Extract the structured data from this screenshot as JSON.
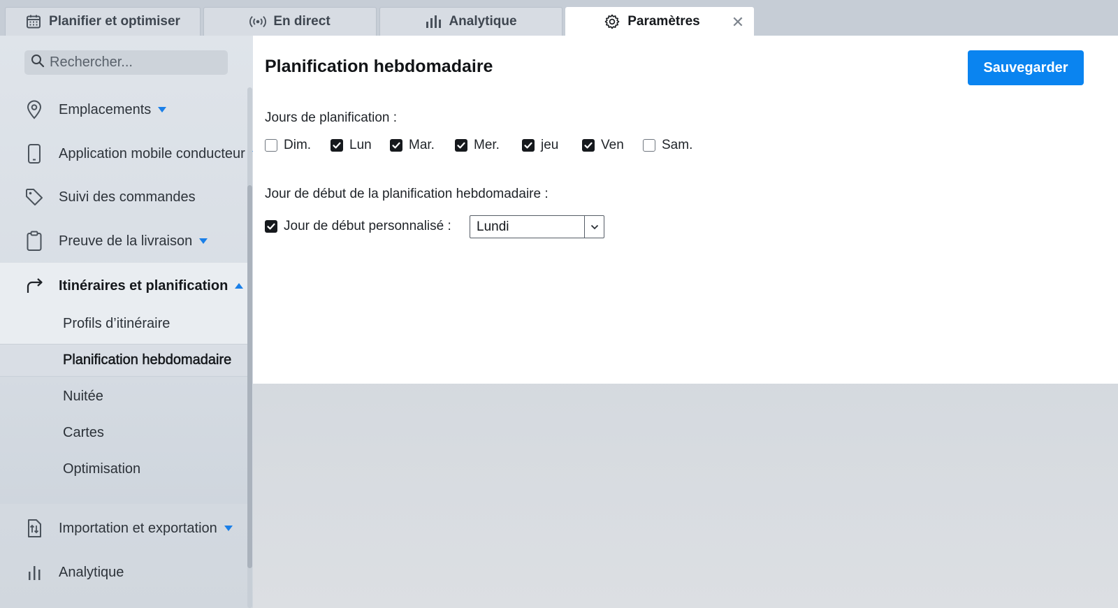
{
  "tabs": [
    {
      "label": "Planifier et optimiser",
      "icon": "calendar-icon"
    },
    {
      "label": "En direct",
      "icon": "broadcast-icon"
    },
    {
      "label": "Analytique",
      "icon": "bar-chart-icon"
    },
    {
      "label": "Paramètres",
      "icon": "gear-icon",
      "active": true
    }
  ],
  "tab_close_glyph": "✕",
  "sidebar": {
    "search_placeholder": "Rechercher...",
    "items": [
      {
        "label": "Emplacements",
        "icon": "map-pin-icon",
        "expandable": true
      },
      {
        "label": "Application mobile conducteur",
        "icon": "mobile-phone-icon",
        "expandable": true
      },
      {
        "label": "Suivi des commandes",
        "icon": "tag-icon",
        "expandable": false
      },
      {
        "label": "Preuve de la livraison",
        "icon": "clipboard-icon",
        "expandable": true
      },
      {
        "label": "Itinéraires et planification",
        "icon": "route-arrow-icon",
        "expanded": true
      },
      {
        "label": "Importation et exportation",
        "icon": "import-export-icon",
        "expandable": true
      },
      {
        "label": "Analytique",
        "icon": "bar-chart-icon",
        "expandable": false
      }
    ],
    "sub_items": [
      {
        "label": "Profils d’itinéraire"
      },
      {
        "label": "Planification hebdomadaire",
        "selected": true
      },
      {
        "label": "Nuitée"
      },
      {
        "label": "Cartes"
      },
      {
        "label": "Optimisation"
      }
    ]
  },
  "panel": {
    "title": "Planification hebdomadaire",
    "save_label": "Sauvegarder",
    "days_label": "Jours de planification :",
    "days": [
      {
        "label": "Dim.",
        "checked": false
      },
      {
        "label": "Lun",
        "checked": true
      },
      {
        "label": "Mar.",
        "checked": true
      },
      {
        "label": "Mer.",
        "checked": true
      },
      {
        "label": "jeu",
        "checked": true
      },
      {
        "label": "Ven",
        "checked": true
      },
      {
        "label": "Sam.",
        "checked": false
      }
    ],
    "start_day_label": "Jour de début de la planification hebdomadaire :",
    "custom_start": {
      "label": "Jour de début personnalisé :",
      "checked": true
    },
    "start_day_value": "Lundi"
  },
  "colors": {
    "accent": "#0a84f0",
    "caret": "#1a7fe8"
  }
}
